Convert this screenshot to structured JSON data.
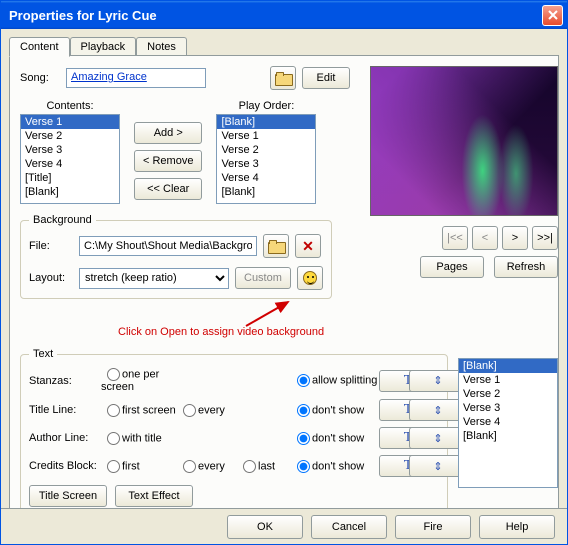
{
  "window": {
    "title": "Properties for Lyric Cue"
  },
  "tabs": {
    "items": [
      "Content",
      "Playback",
      "Notes"
    ],
    "active": 0
  },
  "song": {
    "label": "Song:",
    "value": "Amazing Grace",
    "edit": "Edit"
  },
  "contents": {
    "label": "Contents:",
    "items": [
      "Verse 1",
      "Verse 2",
      "Verse 3",
      "Verse 4",
      "[Title]",
      "[Blank]"
    ],
    "selected": 0
  },
  "playorder": {
    "label": "Play Order:",
    "items": [
      "[Blank]",
      "Verse 1",
      "Verse 2",
      "Verse 3",
      "Verse 4",
      "[Blank]"
    ],
    "selected": 0
  },
  "listbtns": {
    "add": "Add >",
    "remove": "< Remove",
    "clear": "<< Clear"
  },
  "background": {
    "legend": "Background",
    "file_label": "File:",
    "file_value": "C:\\My Shout\\Shout Media\\Backgrou",
    "layout_label": "Layout:",
    "layout_value": "stretch (keep ratio)",
    "custom": "Custom"
  },
  "annotation": "Click on Open to assign video background",
  "nav": {
    "pages": "Pages",
    "refresh": "Refresh"
  },
  "text": {
    "legend": "Text",
    "rows": {
      "stanzas": {
        "label": "Stanzas:",
        "r1": "one per screen",
        "r2": "",
        "r3": "",
        "opt": "allow splitting"
      },
      "title": {
        "label": "Title Line:",
        "r1": "first screen",
        "r2": "every",
        "r3": "",
        "opt": "don't show"
      },
      "author": {
        "label": "Author Line:",
        "r1": "with title",
        "r2": "",
        "r3": "",
        "opt": "don't show"
      },
      "credits": {
        "label": "Credits Block:",
        "r1": "first",
        "r2": "every",
        "r3": "last",
        "opt": "don't show"
      }
    },
    "titlescreen": "Title Screen",
    "texteffect": "Text Effect"
  },
  "sidelist": {
    "items": [
      "[Blank]",
      "Verse 1",
      "Verse 2",
      "Verse 3",
      "Verse 4",
      "[Blank]"
    ],
    "selected": 0
  },
  "buttons": {
    "ok": "OK",
    "cancel": "Cancel",
    "fire": "Fire",
    "help": "Help"
  }
}
